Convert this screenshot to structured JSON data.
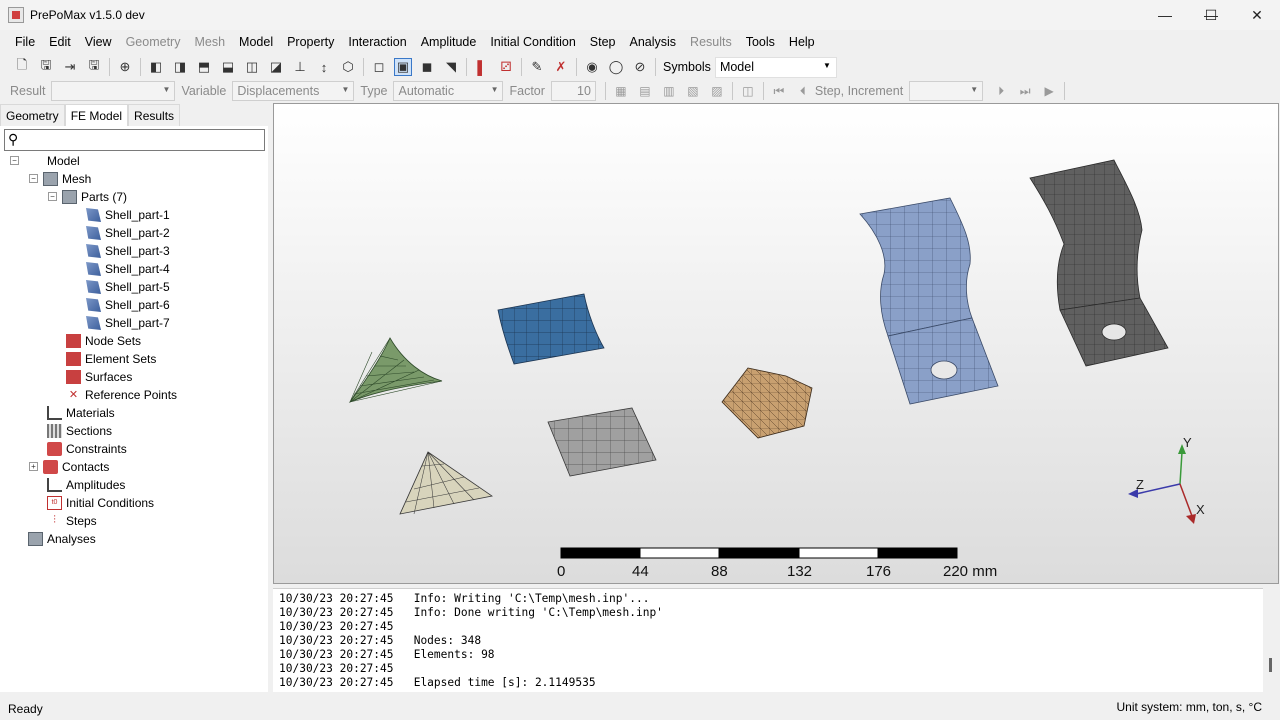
{
  "window": {
    "title": "PrePoMax v1.5.0 dev",
    "controls": {
      "minimize": "—",
      "maximize": "☐",
      "close": "✕"
    }
  },
  "menu": [
    {
      "label": "File",
      "enabled": true
    },
    {
      "label": "Edit",
      "enabled": true
    },
    {
      "label": "View",
      "enabled": true
    },
    {
      "label": "Geometry",
      "enabled": false
    },
    {
      "label": "Mesh",
      "enabled": false
    },
    {
      "label": "Model",
      "enabled": true
    },
    {
      "label": "Property",
      "enabled": true
    },
    {
      "label": "Interaction",
      "enabled": true
    },
    {
      "label": "Amplitude",
      "enabled": true
    },
    {
      "label": "Initial Condition",
      "enabled": true
    },
    {
      "label": "Step",
      "enabled": true
    },
    {
      "label": "Analysis",
      "enabled": true
    },
    {
      "label": "Results",
      "enabled": false
    },
    {
      "label": "Tools",
      "enabled": true
    },
    {
      "label": "Help",
      "enabled": true
    }
  ],
  "toolbar": {
    "symbols_label": "Symbols",
    "symbols_value": "Model"
  },
  "results_toolbar": {
    "result_label": "Result",
    "result_value": "",
    "variable_label": "Variable",
    "variable_value": "Displacements",
    "type_label": "Type",
    "type_value": "Automatic",
    "factor_label": "Factor",
    "factor_value": "10",
    "step_increment_label": "Step, Increment",
    "step_increment_value": ""
  },
  "tabs": [
    "Geometry",
    "FE Model",
    "Results"
  ],
  "active_tab": "FE Model",
  "search": {
    "placeholder": ""
  },
  "tree": {
    "model": "Model",
    "mesh": "Mesh",
    "parts": "Parts (7)",
    "part_items": [
      "Shell_part-1",
      "Shell_part-2",
      "Shell_part-3",
      "Shell_part-4",
      "Shell_part-5",
      "Shell_part-6",
      "Shell_part-7"
    ],
    "node_sets": "Node Sets",
    "element_sets": "Element Sets",
    "surfaces": "Surfaces",
    "reference_points": "Reference Points",
    "materials": "Materials",
    "sections": "Sections",
    "constraints": "Constraints",
    "contacts": "Contacts",
    "amplitudes": "Amplitudes",
    "initial_conditions": "Initial Conditions",
    "steps": "Steps",
    "analyses": "Analyses"
  },
  "viewport": {
    "scale_bar": {
      "ticks": [
        "0",
        "44",
        "88",
        "132",
        "176",
        "220 mm"
      ]
    },
    "axes": {
      "x": "X",
      "y": "Y",
      "z": "Z"
    },
    "colors": {
      "green_part": "#7a9a6a",
      "blue_part": "#3a6ea0",
      "tan_part": "#c8a070",
      "gray_part": "#a0a0a0",
      "beige_part": "#d8d4bc",
      "lightblue_part": "#8aa0c8",
      "dark_part": "#606060"
    }
  },
  "log": [
    "10/30/23 20:27:45   Info: Writing 'C:\\Temp\\mesh.inp'...",
    "10/30/23 20:27:45   Info: Done writing 'C:\\Temp\\mesh.inp'",
    "10/30/23 20:27:45",
    "10/30/23 20:27:45   Nodes: 348",
    "10/30/23 20:27:45   Elements: 98",
    "10/30/23 20:27:45",
    "10/30/23 20:27:45   Elapsed time [s]: 2.1149535"
  ],
  "status": {
    "left": "Ready",
    "right": "Unit system: mm, ton, s, °C"
  }
}
